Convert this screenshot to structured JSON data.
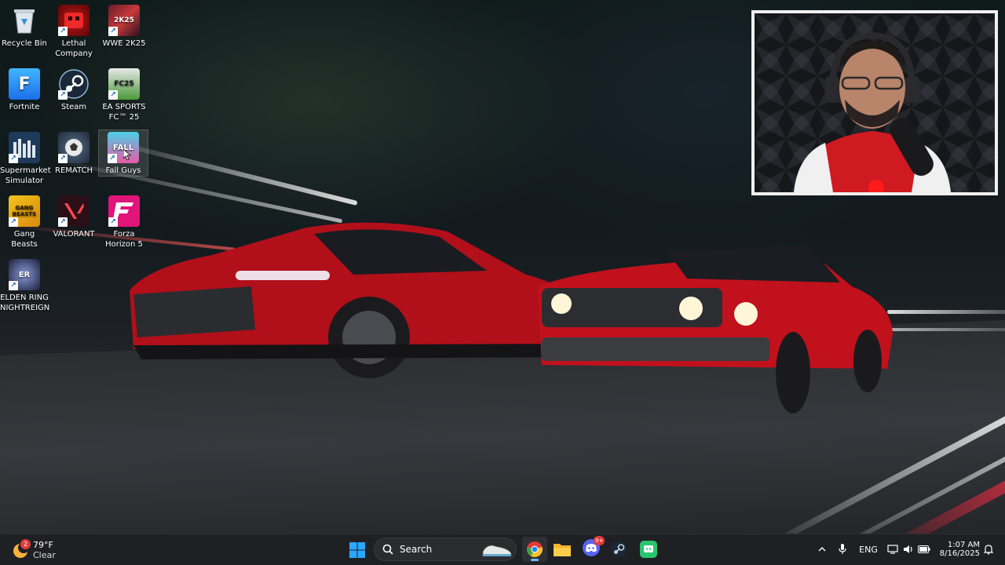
{
  "desktop": {
    "icons": [
      {
        "id": "recycle-bin",
        "label": "Recycle Bin"
      },
      {
        "id": "lethal-company",
        "label": "Lethal Company"
      },
      {
        "id": "wwe-2k25",
        "label": "WWE 2K25"
      },
      {
        "id": "fortnite",
        "label": "Fortnite"
      },
      {
        "id": "steam",
        "label": "Steam"
      },
      {
        "id": "ea-sports-fc-25",
        "label": "EA SPORTS FC™ 25"
      },
      {
        "id": "supermarket-simulator",
        "label": "Supermarket Simulator"
      },
      {
        "id": "rematch",
        "label": "REMATCH"
      },
      {
        "id": "fall-guys",
        "label": "Fall Guys"
      },
      {
        "id": "gang-beasts",
        "label": "Gang Beasts"
      },
      {
        "id": "valorant",
        "label": "VALORANT"
      },
      {
        "id": "forza-horizon-5",
        "label": "Forza Horizon 5"
      },
      {
        "id": "elden-ring-nightreign",
        "label": "ELDEN RING NIGHTREIGN"
      }
    ],
    "tile_texts": {
      "fortnite": "F",
      "fall_guys": "FALL",
      "gang_beasts": "GANG BEASTS",
      "wwe": "2K25",
      "ea_fc": "FC25",
      "elden": "ER"
    }
  },
  "taskbar": {
    "weather": {
      "badge": "2",
      "temperature": "79°F",
      "condition": "Clear"
    },
    "search": {
      "label": "Search"
    },
    "apps": [
      {
        "id": "start",
        "icon": "windows-logo-icon"
      },
      {
        "id": "search",
        "icon": "search-icon"
      },
      {
        "id": "widget",
        "icon": "sneaker-icon"
      },
      {
        "id": "chrome",
        "icon": "chrome-icon"
      },
      {
        "id": "file-explorer",
        "icon": "folder-icon"
      },
      {
        "id": "discord",
        "icon": "discord-icon",
        "badge": "9+"
      },
      {
        "id": "steam",
        "icon": "steam-icon"
      },
      {
        "id": "media-app",
        "icon": "green-app-icon"
      }
    ],
    "tray": {
      "language": "ENG",
      "time": "1:07 AM",
      "date": "8/16/2025"
    }
  },
  "colors": {
    "taskbar_bg": "#1f2023",
    "accent_blue": "#0078d4",
    "car_red": "#c8101c"
  }
}
